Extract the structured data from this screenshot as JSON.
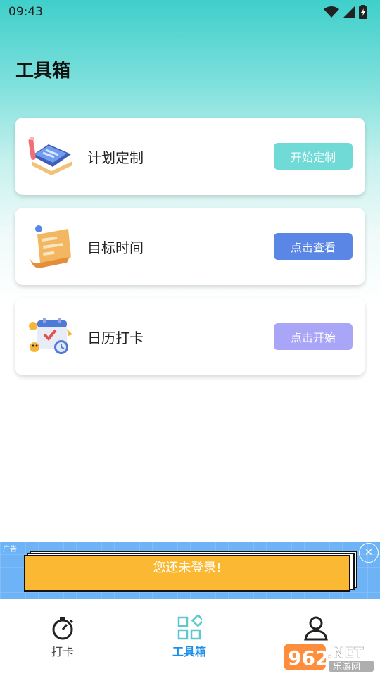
{
  "status_bar": {
    "time": "09:43"
  },
  "page_title": "工具箱",
  "cards": [
    {
      "label": "计划定制",
      "button": "开始定制",
      "button_color": "#6fdad6",
      "icon": "notebook-icon"
    },
    {
      "label": "目标时间",
      "button": "点击查看",
      "button_color": "#5a86e6",
      "icon": "scroll-icon"
    },
    {
      "label": "日历打卡",
      "button": "点击开始",
      "button_color": "#a9a6f8",
      "icon": "calendar-icon"
    }
  ],
  "ad": {
    "tag": "广告",
    "text": "您还未登录!"
  },
  "nav": [
    {
      "label": "打卡",
      "icon": "stopwatch-icon",
      "active": false
    },
    {
      "label": "工具箱",
      "icon": "grid-icon",
      "active": true
    },
    {
      "label": "",
      "icon": "person-icon",
      "active": false
    }
  ],
  "watermark": {
    "number": "962",
    "suffix": ".NET",
    "subtitle": "乐游网"
  },
  "colors": {
    "accent": "#1e8fe8",
    "header_gradient": "#3fcfcb"
  }
}
